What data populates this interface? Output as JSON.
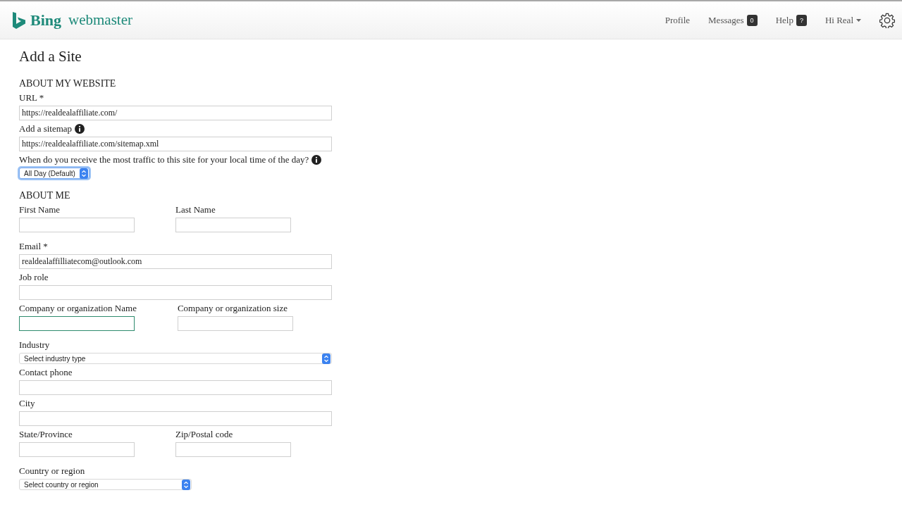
{
  "header": {
    "logo": {
      "brand": "Bing",
      "product": "webmaster"
    },
    "nav": [
      {
        "kind": "link",
        "label": "Profile"
      },
      {
        "kind": "badge",
        "label": "Messages",
        "badge": "0"
      },
      {
        "kind": "badge",
        "label": "Help",
        "badge": "?"
      },
      {
        "kind": "menu",
        "label": "Hi Real"
      }
    ]
  },
  "page_title": "Add a Site",
  "sections": [
    {
      "heading": "ABOUT MY WEBSITE",
      "rows": [
        [
          {
            "kind": "text",
            "label": "URL *",
            "value": "https://realdealaffiliate.com/"
          }
        ],
        [
          {
            "kind": "text",
            "label": "Add a sitemap",
            "info": true,
            "value": "https://realdealaffiliate.com/sitemap.xml"
          }
        ],
        [
          {
            "kind": "select",
            "label": "When do you receive the most traffic to this site for your local time of the day?",
            "info": true,
            "value": "All Day (Default)",
            "focused": true
          }
        ]
      ]
    },
    {
      "heading": "ABOUT ME",
      "rows": [
        [
          {
            "kind": "text",
            "label": "First Name"
          },
          {
            "kind": "text",
            "label": "Last Name"
          }
        ],
        [
          {
            "kind": "text",
            "label": "Email *",
            "value": "realdealaffilliatecom@outlook.com"
          }
        ],
        [
          {
            "kind": "text",
            "label": "Job role"
          }
        ],
        [
          {
            "kind": "text",
            "label": "Company or organization Name",
            "focused": true
          },
          {
            "kind": "text",
            "label": "Company or organization size"
          }
        ],
        [
          {
            "kind": "select",
            "label": "Industry",
            "value": "Select industry type"
          }
        ],
        [
          {
            "kind": "text",
            "label": "Contact phone"
          }
        ],
        [
          {
            "kind": "text",
            "label": "City"
          }
        ],
        [
          {
            "kind": "text",
            "label": "State/Province"
          },
          {
            "kind": "text",
            "label": "Zip/Postal code"
          }
        ],
        [
          {
            "kind": "select",
            "label": "Country or region",
            "value": "Select country or region",
            "compact": true
          }
        ]
      ]
    }
  ]
}
